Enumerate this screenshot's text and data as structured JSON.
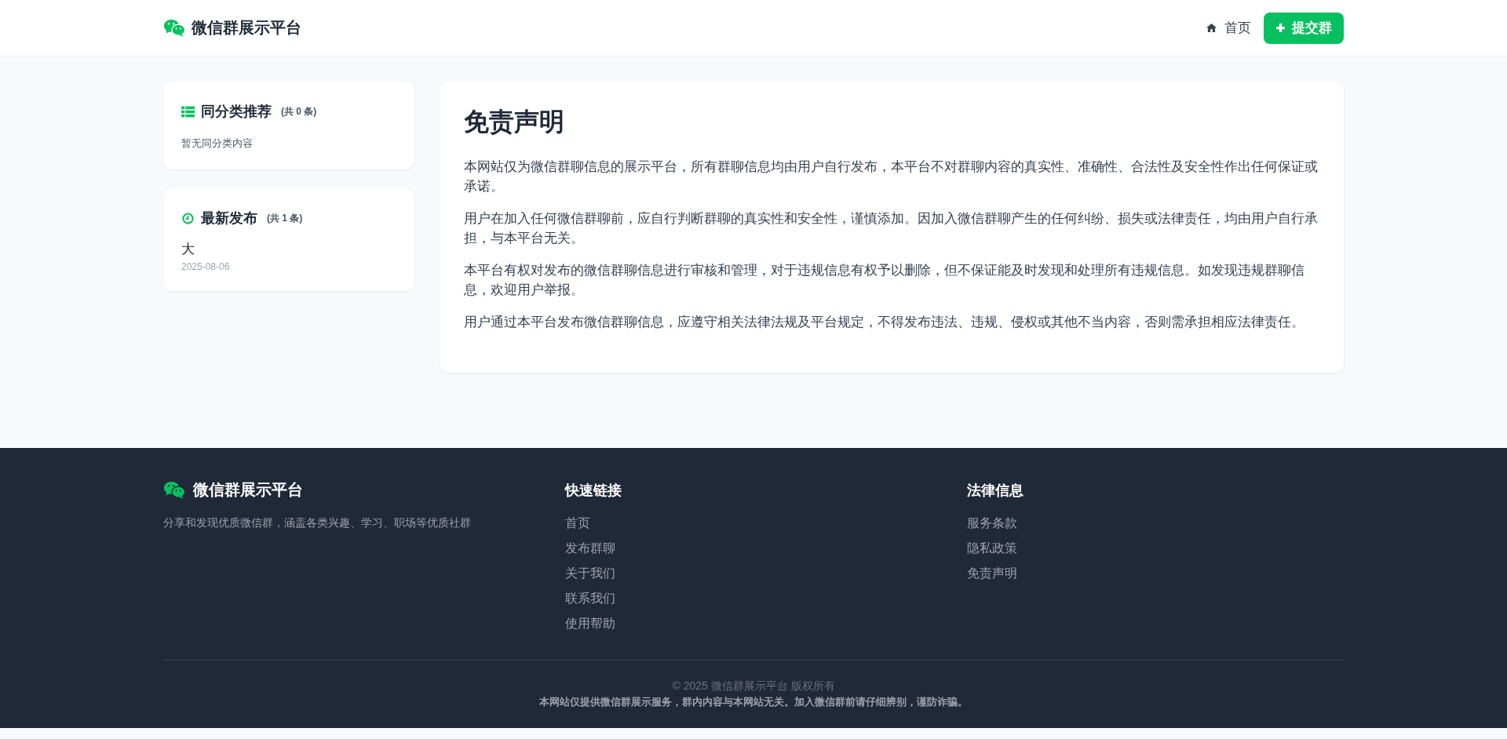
{
  "header": {
    "brand": "微信群展示平台",
    "nav": [
      {
        "label": "首页",
        "kind": "home"
      }
    ],
    "submit_button": "提交群"
  },
  "sidebar": {
    "cards": [
      {
        "title": "同分类推荐",
        "kind": "list",
        "count": "(共 0 条)",
        "empty_text": "暂无同分类内容"
      },
      {
        "title": "最新发布",
        "kind": "clock",
        "count": "(共 1 条)",
        "items": [
          {
            "name": "大",
            "date": "2025-08-06"
          }
        ]
      }
    ]
  },
  "article": {
    "title": "免责声明",
    "paragraphs": [
      "本网站仅为微信群聊信息的展示平台，所有群聊信息均由用户自行发布，本平台不对群聊内容的真实性、准确性、合法性及安全性作出任何保证或承诺。",
      "用户在加入任何微信群聊前，应自行判断群聊的真实性和安全性，谨慎添加。因加入微信群聊产生的任何纠纷、损失或法律责任，均由用户自行承担，与本平台无关。",
      "本平台有权对发布的微信群聊信息进行审核和管理，对于违规信息有权予以删除，但不保证能及时发现和处理所有违规信息。如发现违规群聊信息，欢迎用户举报。",
      "用户通过本平台发布微信群聊信息，应遵守相关法律法规及平台规定，不得发布违法、违规、侵权或其他不当内容，否则需承担相应法律责任。"
    ]
  },
  "footer": {
    "brand": "微信群展示平台",
    "tagline": "分享和发现优质微信群，涵盖各类兴趣、学习、职场等优质社群",
    "columns": [
      {
        "title": "快速链接",
        "links": [
          "首页",
          "发布群聊",
          "关于我们",
          "联系我们",
          "使用帮助"
        ]
      },
      {
        "title": "法律信息",
        "links": [
          "服务条款",
          "隐私政策",
          "免责声明"
        ]
      }
    ],
    "copyright": "© 2025 微信群展示平台 版权所有",
    "notice": "本网站仅提供微信群展示服务，群内内容与本网站无关。加入微信群前请仔细辨别，谨防诈骗。"
  }
}
